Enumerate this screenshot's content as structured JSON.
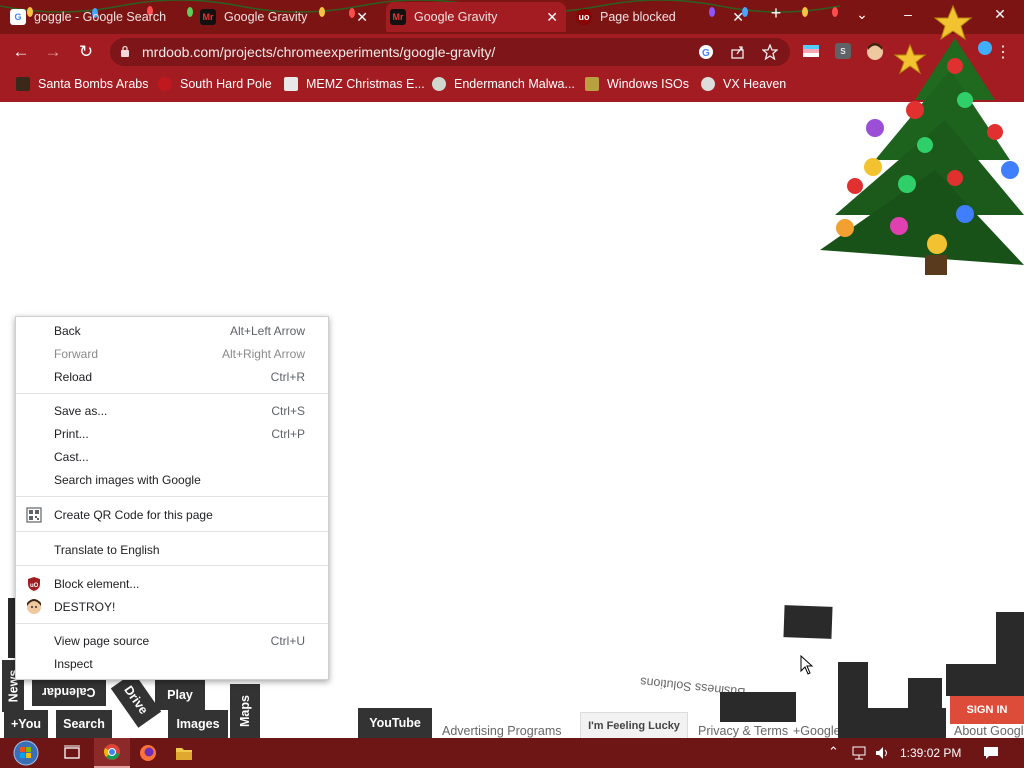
{
  "tabs": [
    {
      "title": "goggle - Google Search",
      "favicon": "google-g-icon"
    },
    {
      "title": "Google Gravity",
      "favicon": "mr-doob-icon"
    },
    {
      "title": "Google Gravity",
      "favicon": "mr-doob-icon"
    },
    {
      "title": "Page blocked",
      "favicon": "ublock-icon"
    }
  ],
  "window_controls": {
    "minimize": "–",
    "close": "✕",
    "new_tab": "+",
    "tab_search": "⌄"
  },
  "toolbar": {
    "url": "mrdoob.com/projects/chromeexperiments/google-gravity/"
  },
  "bookmarks": [
    {
      "label": "Santa Bombs Arabs",
      "icon": "bookmark-icon"
    },
    {
      "label": "South Hard Pole",
      "icon": "bookmark-icon"
    },
    {
      "label": "MEMZ Christmas E...",
      "icon": "bookmark-icon"
    },
    {
      "label": "Endermanch Malwa...",
      "icon": "bookmark-icon"
    },
    {
      "label": "Windows ISOs",
      "icon": "bookmark-icon"
    },
    {
      "label": "VX Heaven",
      "icon": "bookmark-icon"
    }
  ],
  "page": {
    "tiles": {
      "news": "News",
      "calendar": "Calendar",
      "drive": "Drive",
      "play": "Play",
      "maps": "Maps",
      "you": "+You",
      "search": "Search",
      "images": "Images",
      "youtube": "YouTube",
      "lucky": "I'm Feeling Lucky",
      "signin": "SIGN IN"
    },
    "texts": {
      "advertising": "Advertising Programs",
      "privacy": "Privacy & Terms",
      "plus_google": "+Google",
      "about": "About Google",
      "business": "Business Solutions"
    }
  },
  "context_menu": {
    "items": [
      {
        "label": "Back",
        "shortcut": "Alt+Left Arrow",
        "disabled": false
      },
      {
        "label": "Forward",
        "shortcut": "Alt+Right Arrow",
        "disabled": true
      },
      {
        "label": "Reload",
        "shortcut": "Ctrl+R",
        "disabled": false
      },
      {
        "label": "Save as...",
        "shortcut": "Ctrl+S",
        "disabled": false
      },
      {
        "label": "Print...",
        "shortcut": "Ctrl+P",
        "disabled": false
      },
      {
        "label": "Cast...",
        "shortcut": "",
        "disabled": false
      },
      {
        "label": "Search images with Google",
        "shortcut": "",
        "disabled": false
      },
      {
        "label": "Create QR Code for this page",
        "shortcut": "",
        "disabled": false,
        "icon": "qr-code-icon"
      },
      {
        "label": "Translate to English",
        "shortcut": "",
        "disabled": false
      },
      {
        "label": "Block element...",
        "shortcut": "",
        "disabled": false,
        "icon": "ublock-icon"
      },
      {
        "label": "DESTROY!",
        "shortcut": "",
        "disabled": false,
        "icon": "avatar-icon"
      },
      {
        "label": "View page source",
        "shortcut": "Ctrl+U",
        "disabled": false
      },
      {
        "label": "Inspect",
        "shortcut": "",
        "disabled": false
      }
    ]
  },
  "taskbar": {
    "clock": "1:39:02 PM"
  },
  "colors": {
    "tab_strip": "#7c1414",
    "toolbar": "#a31c22",
    "taskbar": "#6e1616",
    "signin": "#dd4b39"
  }
}
